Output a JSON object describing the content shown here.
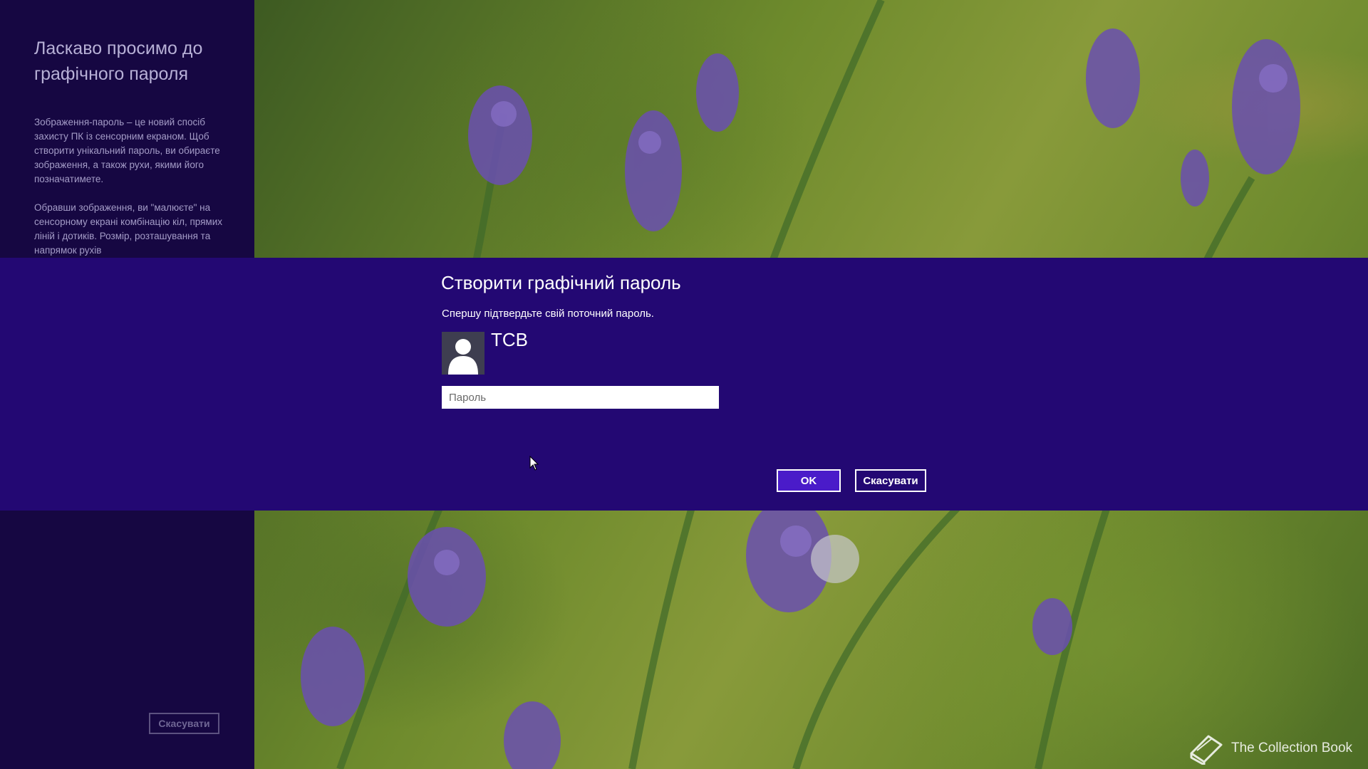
{
  "welcome": {
    "title": "Ласкаво просимо до графічного пароля",
    "paragraph1": "Зображення-пароль – це новий спосіб захисту ПК із сенсорним екраном. Щоб створити унікальний пароль, ви обираєте зображення, а також рухи, якими його позначатимете.",
    "paragraph2": "Обравши зображення, ви \"малюєте\" на сенсорному екрані комбінацію кіл, прямих ліній і дотиків. Розмір, розташування та напрямок рухів",
    "cancel_label": "Скасувати"
  },
  "dialog": {
    "title": "Створити графічний пароль",
    "subtitle": "Спершу підтвердьте свій поточний пароль.",
    "username": "TCB",
    "password_placeholder": "Пароль",
    "password_value": "",
    "ok_label": "OK",
    "cancel_label": "Скасувати"
  },
  "watermark": {
    "text": "The Collection Book",
    "icon": "book-icon"
  },
  "colors": {
    "dialog_band": "#230873",
    "left_panel": "#160742",
    "ok_button": "#4a1bc9"
  }
}
